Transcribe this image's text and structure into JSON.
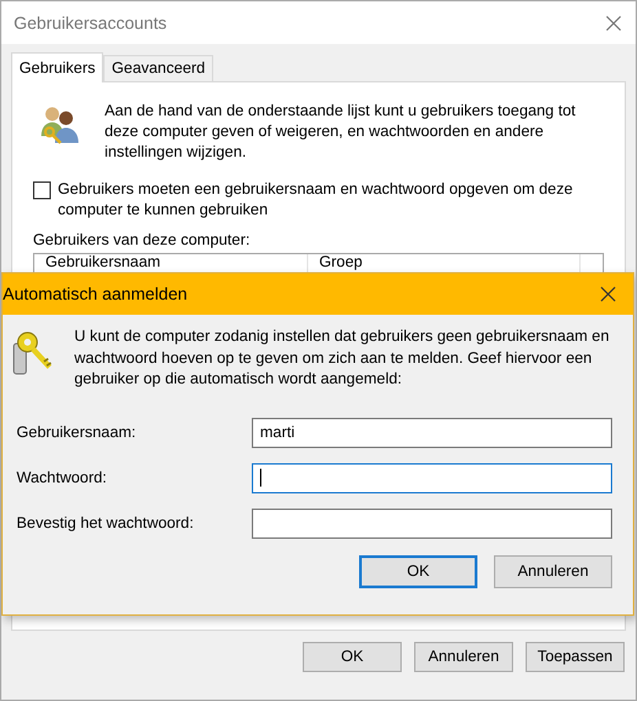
{
  "window": {
    "title": "Gebruikersaccounts"
  },
  "tabs": [
    {
      "label": "Gebruikers",
      "selected": true
    },
    {
      "label": "Geavanceerd",
      "selected": false
    }
  ],
  "intro": "Aan de hand van de onderstaande lijst kunt u gebruikers toegang tot deze computer geven of weigeren, en wachtwoorden en andere instellingen wijzigen.",
  "require_login": {
    "label": "Gebruikers moeten een gebruikersnaam en wachtwoord opgeven om deze computer te kunnen gebruiken",
    "checked": false
  },
  "users_label": "Gebruikers van deze computer:",
  "users_table": {
    "columns": [
      "Gebruikersnaam",
      "Groep"
    ]
  },
  "buttons": [
    {
      "label": "OK",
      "default": false
    },
    {
      "label": "Annuleren",
      "default": false
    },
    {
      "label": "Toepassen",
      "default": false
    }
  ],
  "dialog": {
    "title": "Automatisch aanmelden",
    "description": "U kunt de computer zodanig instellen dat gebruikers geen gebruikersnaam en wachtwoord hoeven op te geven om zich aan te melden. Geef hiervoor een gebruiker op die automatisch wordt aangemeld:",
    "fields": [
      {
        "label": "Gebruikersnaam:",
        "value": "marti",
        "focused": false
      },
      {
        "label": "Wachtwoord:",
        "focused": true
      },
      {
        "label": "Bevestig het wachtwoord:",
        "focused": false
      }
    ],
    "buttons": [
      {
        "label": "OK",
        "default": true
      },
      {
        "label": "Annuleren",
        "default": false
      }
    ]
  }
}
